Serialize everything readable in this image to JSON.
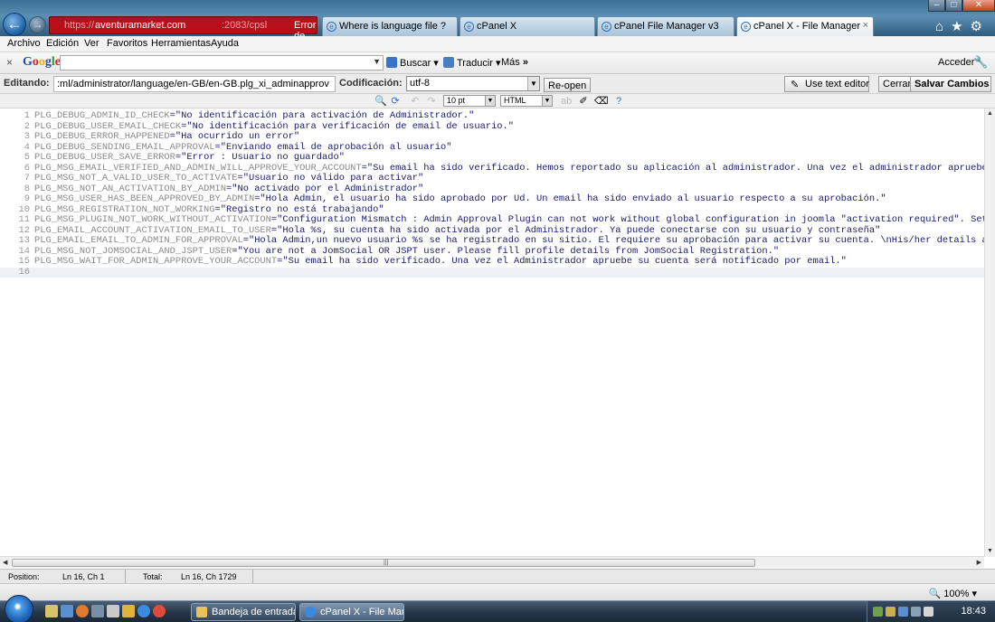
{
  "browser": {
    "url_scheme": "https://",
    "url_host": "aventuramarket.com",
    "url_mid": ":2083/cpsl",
    "cert_error": "Error de ...",
    "tabs": [
      {
        "label": "Where is language file ?"
      },
      {
        "label": "cPanel X"
      },
      {
        "label": "cPanel File Manager v3"
      },
      {
        "label": "cPanel X - File Manager"
      }
    ],
    "active_tab_close": "×"
  },
  "menu": [
    "Archivo",
    "Edición",
    "Ver",
    "Favoritos",
    "Herramientas",
    "Ayuda"
  ],
  "google": {
    "logo": "Google",
    "search_value": "",
    "buscar": "Buscar",
    "traducir": "Traducir",
    "mas": "Más",
    "acceder": "Acceder"
  },
  "editor": {
    "editing_label": "Editando:",
    "path": ":ml/administrator/language/en-GB/en-GB.plg_xi_adminapprov",
    "encoding_label": "Codificación:",
    "encoding": "utf-8",
    "reopen": "Re-open",
    "use_text_editor": "Use text editor",
    "close": "Cerrar",
    "save": "Salvar Cambios",
    "font_size": "10 pt",
    "syntax": "HTML"
  },
  "code": [
    {
      "n": "1",
      "k": "PLG_DEBUG_ADMIN_ID_CHECK",
      "v": "=\"No identificación para activación de Administrador.\""
    },
    {
      "n": "2",
      "k": "PLG_DEBUG_USER_EMAIL_CHECK",
      "v": "=\"No identificación para verificación de email de usuario.\""
    },
    {
      "n": "3",
      "k": "PLG_DEBUG_ERROR_HAPPENED",
      "v": "=\"Ha ocurrido un error\""
    },
    {
      "n": "4",
      "k": "PLG_DEBUG_SENDING_EMAIL_APPROVAL",
      "v": "=\"Enviando email de aprobación al usuario\""
    },
    {
      "n": "5",
      "k": "PLG_DEBUG_USER_SAVE_ERROR",
      "v": "=\"Error : Usuario no guardado\""
    },
    {
      "n": "6",
      "k": "PLG_MSG_EMAIL_VERIFIED_AND_ADMIN_WILL_APPROVE_YOUR_ACCOUNT",
      "v": "=\"Su email ha sido verificado. Hemos reportado su aplicación al administrador. Una vez el administrador apruebe su"
    },
    {
      "n": "7",
      "k": "PLG_MSG_NOT_A_VALID_USER_TO_ACTIVATE",
      "v": "=\"Usuario no válido para activar\""
    },
    {
      "n": "8",
      "k": "PLG_MSG_NOT_AN_ACTIVATION_BY_ADMIN",
      "v": "=\"No activado por el Administrador\""
    },
    {
      "n": "9",
      "k": "PLG_MSG_USER_HAS_BEEN_APPROVED_BY_ADMIN",
      "v": "=\"Hola Admin, el usuario ha sido aprobado por Ud. Un email ha sido enviado al usuario respecto a su aprobación.\""
    },
    {
      "n": "10",
      "k": "PLG_MSG_REGISTRATION_NOT_WORKING",
      "v": "=\"Registro no está trabajando\""
    },
    {
      "n": "11",
      "k": "PLG_MSG_PLUGIN_NOT_WORK_WITHOUT_ACTIVATION",
      "v": "=\"Configuration Mismatch : Admin Approval Plugin can not work without global configuration in joomla \"activation required\". Set it"
    },
    {
      "n": "12",
      "k": "PLG_EMAIL_ACCOUNT_ACTIVATION_EMAIL_TO_USER",
      "v": "=\"Hola %s, su cuenta ha sido activada por el Administrador. Ya puede conectarse con su usuario y contraseña\""
    },
    {
      "n": "13",
      "k": "PLG_EMAIL_EMAIL_TO_ADMIN_FOR_APPROVAL",
      "v": "=\"Hola Admin,un nuevo usuario %s se ha registrado en su sitio. El requiere su aprobación para activar su cuenta. \\nHis/her details are:"
    },
    {
      "n": "14",
      "k": "PLG_MSG_NOT_JOMSOCIAL_AND_JSPT_USER",
      "v": "=\"You are not a JomSocial OR JSPT user. Please fill profile details from JomSocial Registration.\""
    },
    {
      "n": "15",
      "k": "PLG_MSG_WAIT_FOR_ADMIN_APPROVE_YOUR_ACCOUNT",
      "v": "=\"Su email ha sido verificado. Una vez el Administrador apruebe su cuenta será notificado por email.\""
    },
    {
      "n": "16",
      "k": "",
      "v": ""
    }
  ],
  "status": {
    "position_label": "Position:",
    "position_value": "Ln 16, Ch 1",
    "total_label": "Total:",
    "total_value": "Ln 16, Ch 1729"
  },
  "ie": {
    "zoom": "100%"
  },
  "taskbar": {
    "tasks": [
      {
        "label": "Bandeja de entrada ..."
      },
      {
        "label": "cPanel X - File Mana..."
      }
    ],
    "clock": "18:43"
  }
}
